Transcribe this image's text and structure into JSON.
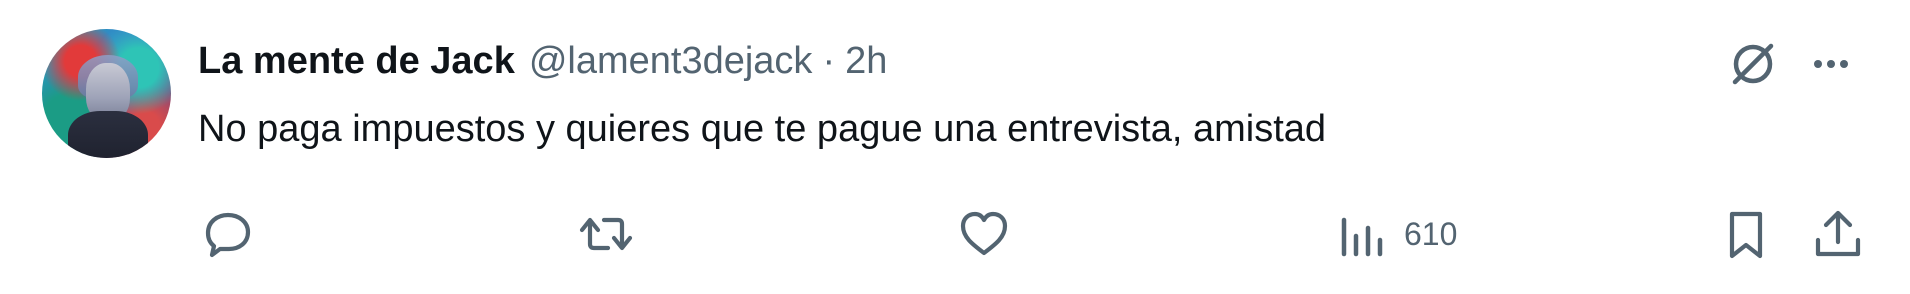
{
  "author": {
    "display_name": "La mente de Jack",
    "handle": "@lament3dejack",
    "separator": "·",
    "time": "2h"
  },
  "tweet": {
    "text": "No paga impuestos y quieres que te pague una entrevista, amistad"
  },
  "actions": {
    "views_count": "610"
  },
  "icons": {
    "grok": "grok-icon",
    "more": "more-icon",
    "reply": "reply-icon",
    "retweet": "retweet-icon",
    "like": "heart-icon",
    "views": "analytics-icon",
    "bookmark": "bookmark-icon",
    "share": "share-icon"
  },
  "colors": {
    "text_primary": "#0f1419",
    "text_secondary": "#536471"
  }
}
